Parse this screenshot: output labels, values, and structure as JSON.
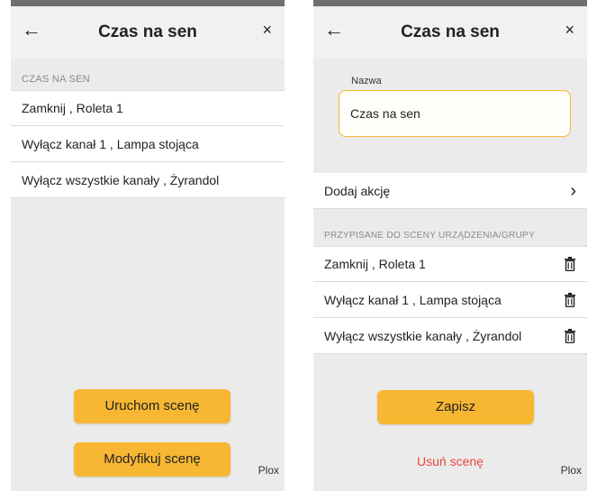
{
  "left": {
    "header": {
      "back_icon": "←",
      "title": "Czas na sen",
      "close_icon": "×"
    },
    "section_label": "CZAS NA SEN",
    "items": [
      "Zamknij , Roleta 1",
      "Wyłącz kanał 1 , Lampa stojąca",
      "Wyłącz wszystkie kanały , Żyrandol"
    ],
    "run_button": "Uruchom scenę",
    "modify_button": "Modyfikuj scenę",
    "footer": "Plox"
  },
  "right": {
    "header": {
      "back_icon": "←",
      "title": "Czas na sen",
      "close_icon": "×"
    },
    "name_label": "Nazwa",
    "name_value": "Czas na sen",
    "add_action": "Dodaj akcję",
    "add_action_chevron": "›",
    "section_label": "PRZYPISANE DO SCENY URZĄDZENIA/GRUPY",
    "items": [
      "Zamknij , Roleta 1",
      "Wyłącz kanał 1 , Lampa stojąca",
      "Wyłącz wszystkie kanały , Żyrandol"
    ],
    "save_button": "Zapisz",
    "delete_link": "Usuń scenę",
    "footer": "Plox"
  },
  "colors": {
    "accent": "#f7b733",
    "danger": "#e8473a",
    "background": "#ebebeb"
  }
}
